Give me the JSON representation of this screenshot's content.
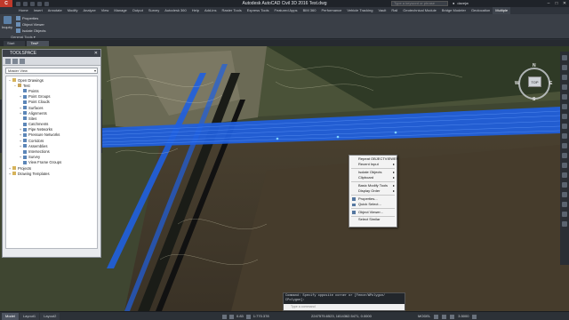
{
  "app": {
    "icon_label": "C",
    "title": "Autodesk AutoCAD Civil 3D 2016    Test.dwg",
    "search_placeholder": "Type a keyword or phrase",
    "user": "davejw",
    "win_buttons": [
      "–",
      "□",
      "✕"
    ]
  },
  "ribbon": {
    "tabs": [
      "Home",
      "Insert",
      "Annotate",
      "Modify",
      "Analyze",
      "View",
      "Manage",
      "Output",
      "Survey",
      "Autodesk 360",
      "Help",
      "Add-ins",
      "Raster Tools",
      "Express Tools",
      "Featured Apps",
      "BIM 360",
      "Performance",
      "Vehicle Tracking",
      "Vault",
      "Rail",
      "Geotechnical Module",
      "Bridge Modeler",
      "Geolocation",
      "Multiple"
    ],
    "active_tab": "Multiple",
    "inquiry_label": "Inquiry",
    "panel_items": [
      "Properties",
      "Object Viewer",
      "Isolate Objects"
    ],
    "panel_footer": "General Tools ▾"
  },
  "file_tabs": [
    "Start",
    "Test*"
  ],
  "toolspace": {
    "title": "TOOLSPACE",
    "close": "✕",
    "view_dropdown": "Master View",
    "tree": [
      {
        "label": "Open Drawings",
        "level": 0,
        "exp": "−",
        "icon": "fold"
      },
      {
        "label": "Test",
        "level": 1,
        "exp": "−",
        "icon": "doc"
      },
      {
        "label": "Points",
        "level": 2,
        "exp": "",
        "icon": "item"
      },
      {
        "label": "Point Groups",
        "level": 2,
        "exp": "+",
        "icon": "item"
      },
      {
        "label": "Point Clouds",
        "level": 2,
        "exp": "",
        "icon": "item"
      },
      {
        "label": "Surfaces",
        "level": 2,
        "exp": "+",
        "icon": "item"
      },
      {
        "label": "Alignments",
        "level": 2,
        "exp": "+",
        "icon": "item"
      },
      {
        "label": "Sites",
        "level": 2,
        "exp": "",
        "icon": "item"
      },
      {
        "label": "Catchments",
        "level": 2,
        "exp": "",
        "icon": "item"
      },
      {
        "label": "Pipe Networks",
        "level": 2,
        "exp": "+",
        "icon": "item"
      },
      {
        "label": "Pressure Networks",
        "level": 2,
        "exp": "+",
        "icon": "item"
      },
      {
        "label": "Corridors",
        "level": 2,
        "exp": "+",
        "icon": "item"
      },
      {
        "label": "Assemblies",
        "level": 2,
        "exp": "+",
        "icon": "item"
      },
      {
        "label": "Intersections",
        "level": 2,
        "exp": "",
        "icon": "item"
      },
      {
        "label": "Survey",
        "level": 2,
        "exp": "+",
        "icon": "item"
      },
      {
        "label": "View Frame Groups",
        "level": 2,
        "exp": "",
        "icon": "item"
      },
      {
        "label": "Projects",
        "level": 0,
        "exp": "+",
        "icon": "fold"
      },
      {
        "label": "Drawing Templates",
        "level": 0,
        "exp": "+",
        "icon": "fold"
      }
    ]
  },
  "context_menu": {
    "items": [
      {
        "label": "Repeat OBJECTVIEWER",
        "sub": false,
        "icon": false
      },
      {
        "label": "Recent Input",
        "sub": true,
        "icon": false
      },
      {
        "sep": true
      },
      {
        "label": "Isolate Objects",
        "sub": true,
        "icon": false
      },
      {
        "label": "Clipboard",
        "sub": true,
        "icon": false
      },
      {
        "sep": true
      },
      {
        "label": "Basic Modify Tools",
        "sub": true,
        "icon": false
      },
      {
        "label": "Display Order",
        "sub": true,
        "icon": false
      },
      {
        "sep": true
      },
      {
        "label": "Properties...",
        "sub": false,
        "icon": true
      },
      {
        "label": "Quick Select...",
        "sub": false,
        "icon": true
      },
      {
        "sep": true
      },
      {
        "label": "Object Viewer...",
        "sub": false,
        "icon": true
      },
      {
        "sep": true
      },
      {
        "label": "Select Similar",
        "sub": false,
        "icon": false
      }
    ]
  },
  "viewcube": {
    "top": "TOP",
    "north": "N",
    "south": "S",
    "east": "E",
    "west": "W"
  },
  "command": {
    "line1": "Command: Specify opposite corner or [Fence/WPolygon/",
    "line2": "CPolygon]:",
    "input_placeholder": "Type a command"
  },
  "status": {
    "tabs": [
      "Model",
      "Layout1",
      "Layout2"
    ],
    "active_tab": "Model",
    "scale": "1:770.378",
    "elevation": "0.83",
    "coords": "2247575.6523, 1814362.5471, 0.0000",
    "mode": "MODEL",
    "precision": "3.5000"
  },
  "colors": {
    "corridor": "#1f5fe0",
    "menu_bg": "#f3f3f3",
    "titlebar": "#1f2329"
  }
}
